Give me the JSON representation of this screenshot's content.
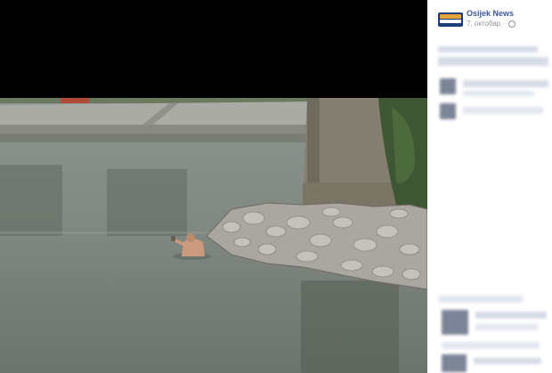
{
  "post": {
    "page_name": "Osijek News",
    "date": "7. октобар",
    "separator": "·",
    "privacy_icon": "globe-icon",
    "accent_color": "#3b5998"
  },
  "photo": {
    "description_icon": "photo"
  }
}
